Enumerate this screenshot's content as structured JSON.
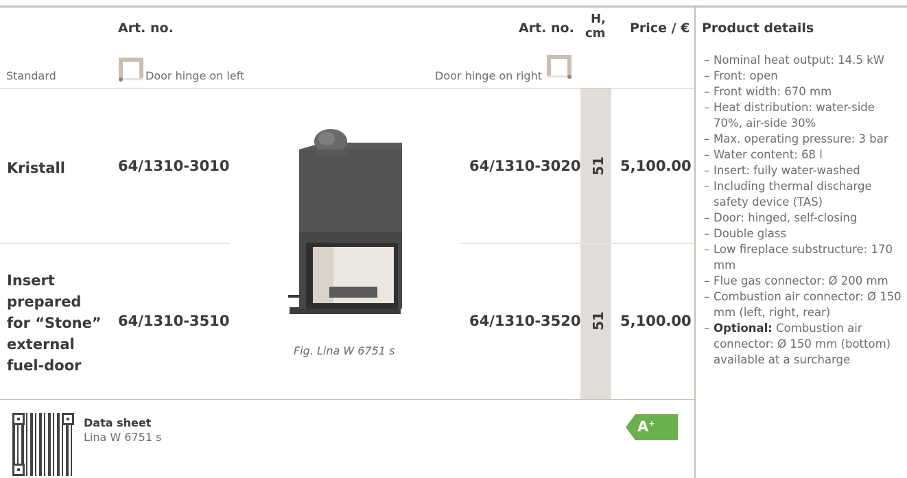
{
  "header": {
    "art_no_left": "Art. no.",
    "art_no_right": "Art. no.",
    "height_label_line1": "H,",
    "height_label_line2": "cm",
    "price_label": "Price / €",
    "details_label": "Product details"
  },
  "standard_row": {
    "label": "Standard",
    "hinge_left": "Door hinge on left",
    "hinge_right": "Door hinge on right"
  },
  "rows": [
    {
      "name_lines": [
        "Kristall"
      ],
      "art_left": "64/1310-3010",
      "art_right": "64/1310-3020",
      "height": "51",
      "price": "5,100.00"
    },
    {
      "name_lines": [
        "Insert",
        "prepared",
        "for “Stone”",
        "external",
        "fuel-door"
      ],
      "art_left": "64/1310-3510",
      "art_right": "64/1310-3520",
      "height": "51",
      "price": "5,100.00"
    }
  ],
  "figure_caption": "Fig. Lina W 6751 s",
  "footer": {
    "data_sheet_title": "Data sheet",
    "data_sheet_name": "Lina W 6751 s",
    "energy_label": "A",
    "energy_sup": "+",
    "energy_color": "#6ab04c"
  },
  "details": [
    {
      "text": "Nominal heat output: 14.5 kW"
    },
    {
      "text": "Front: open"
    },
    {
      "text": "Front width: 670 mm"
    },
    {
      "text": "Heat distribution: water-side 70%, air-side 30%"
    },
    {
      "text": "Max. operating pressure: 3 bar"
    },
    {
      "text": "Water content: 68 l"
    },
    {
      "text": "Insert: fully water-washed"
    },
    {
      "text": "Including thermal discharge safety device (TAS)"
    },
    {
      "text": "Door: hinged, self-closing"
    },
    {
      "text": "Double glass"
    },
    {
      "text": "Low fireplace substructure: 170 mm"
    },
    {
      "text": "Flue gas connector: Ø 200 mm"
    },
    {
      "text": "Combustion air connector: Ø 150 mm (left, right, rear)"
    },
    {
      "strong": "Optional:",
      "text": "Combustion air connector: Ø 150 mm (bottom) available at a surcharge"
    }
  ]
}
